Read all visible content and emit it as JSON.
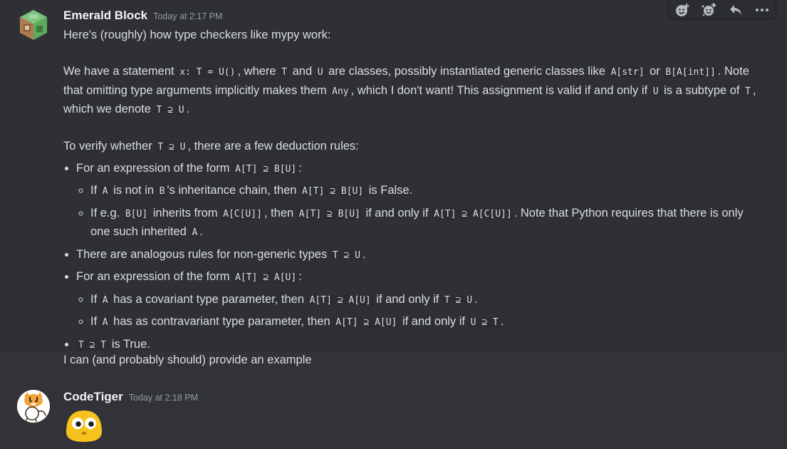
{
  "messages": [
    {
      "author": "Emerald Block",
      "timestamp": "Today at 2:17 PM",
      "avatar_icon": "command-block-icon",
      "intro": "Here's (roughly) how type checkers like mypy work:",
      "p2": {
        "t1": "We have a statement ",
        "c1": "x: T = U()",
        "t2": ", where ",
        "c2": "T",
        "t3": " and ",
        "c3": "U",
        "t4": " are classes, possibly instantiated generic classes like ",
        "c4": "A[str]",
        "t5": " or ",
        "c5": "B[A[int]]",
        "t6": ". Note that omitting type arguments implicitly makes them ",
        "c6": "Any",
        "t7": ", which I don't want! This assignment is valid if and only if ",
        "c7": "U",
        "t8": " is a subtype of ",
        "c8": "T",
        "t9": ", which we denote ",
        "c9": "T ⊇ U",
        "t10": "."
      },
      "p3": {
        "t1": "To verify whether ",
        "c1": "T ⊇ U",
        "t2": ", there are a few deduction rules:"
      },
      "b1": {
        "t1": "For an expression of the form ",
        "c1": "A[T] ⊇ B[U]",
        "t2": ":",
        "s1": {
          "t1": "If ",
          "c1": "A",
          "t2": " is not in ",
          "c2": "B",
          "t3": "'s inheritance chain, then ",
          "c3": "A[T] ⊇ B[U]",
          "t4": " is False."
        },
        "s2": {
          "t1": "If e.g. ",
          "c1": "B[U]",
          "t2": " inherits from ",
          "c2": "A[C[U]]",
          "t3": ", then ",
          "c3": "A[T] ⊇ B[U]",
          "t4": " if and only if ",
          "c4": "A[T] ⊇ A[C[U]]",
          "t5": ". Note that Python requires that there is only one such inherited ",
          "c5": "A",
          "t6": "."
        }
      },
      "b2": {
        "t1": "There are analogous rules for non-generic types ",
        "c1": "T ⊇ U",
        "t2": "."
      },
      "b3": {
        "t1": "For an expression of the form ",
        "c1": "A[T] ⊇ A[U]",
        "t2": ":",
        "s1": {
          "t1": "If ",
          "c1": "A",
          "t2": " has a covariant type parameter, then ",
          "c2": "A[T] ⊇ A[U]",
          "t3": " if and only if ",
          "c3": "T ⊇ U",
          "t4": "."
        },
        "s2": {
          "t1": "If ",
          "c1": "A",
          "t2": " has as contravariant type parameter, then ",
          "c2": "A[T] ⊇ A[U]",
          "t3": " if and only if ",
          "c3": "U ⊇ T",
          "t4": "."
        }
      },
      "b4": {
        "c1": "T ⊇ T",
        "t1": " is True."
      },
      "followup": "I can (and probably should) provide an example"
    },
    {
      "author": "CodeTiger",
      "timestamp": "Today at 2:18 PM",
      "avatar_icon": "tiger-cartoon-icon",
      "emoji": "flushed-blob-emoji"
    }
  ],
  "toolbar": {
    "buttons": [
      "add-reaction-icon",
      "super-reaction-icon",
      "reply-icon",
      "more-icon"
    ]
  },
  "colors": {
    "background": "#313338",
    "hover_background": "#2e3035",
    "username": "#f2f3f5",
    "text": "#dbdee1",
    "timestamp": "#949ba4",
    "code_bg": "#2b2d31"
  }
}
